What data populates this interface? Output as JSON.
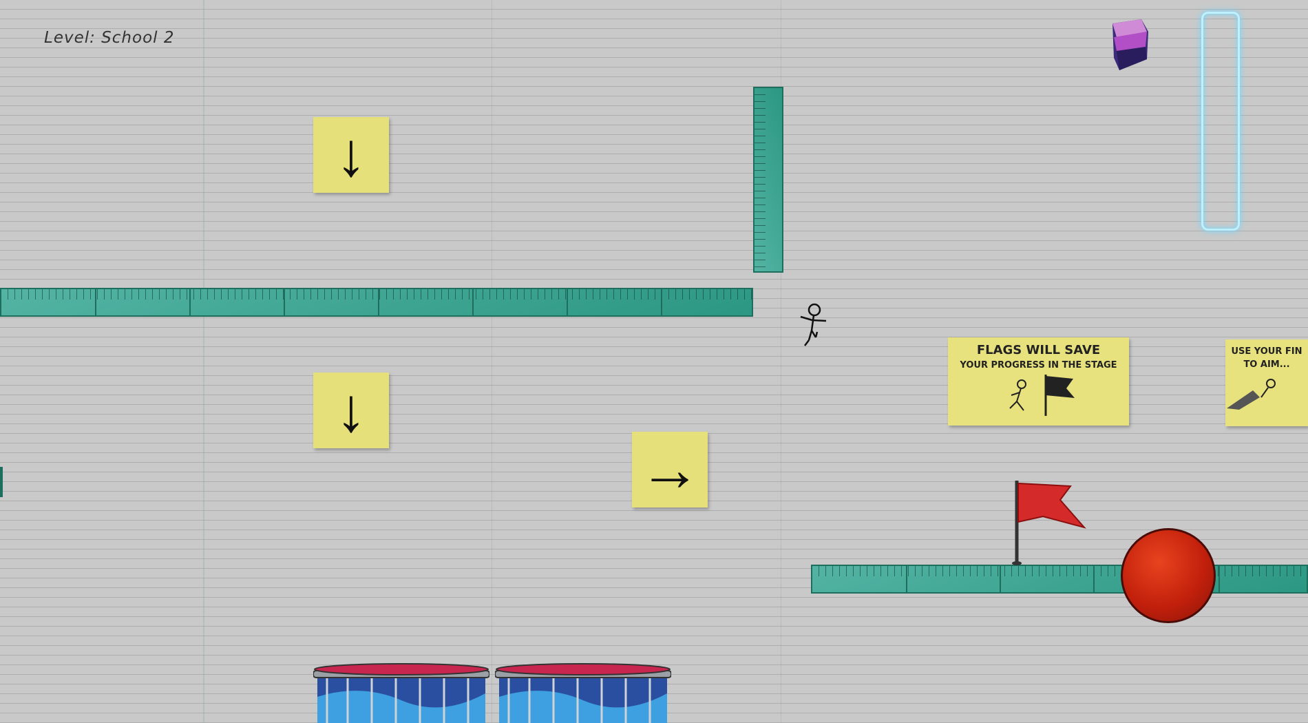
{
  "hud": {
    "level_label": "Level: School 2"
  },
  "stickies": {
    "arrow_down_1": "↓",
    "arrow_down_2": "↓",
    "arrow_right": "→"
  },
  "tip_notes": {
    "flags": {
      "title": "FLAGS WILL SAVE",
      "line2": "YOUR PROGRESS IN THE STAGE"
    },
    "aim": {
      "line1": "USE YOUR FIN",
      "line2": "TO AIM..."
    }
  },
  "colors": {
    "ruler": "#2f9f8a",
    "sticky": "#e6e07a",
    "flag": "#d42a2a",
    "ball": "#c3200c",
    "eraser": "#b24fc7",
    "meter_glow": "#6fd8ff"
  }
}
